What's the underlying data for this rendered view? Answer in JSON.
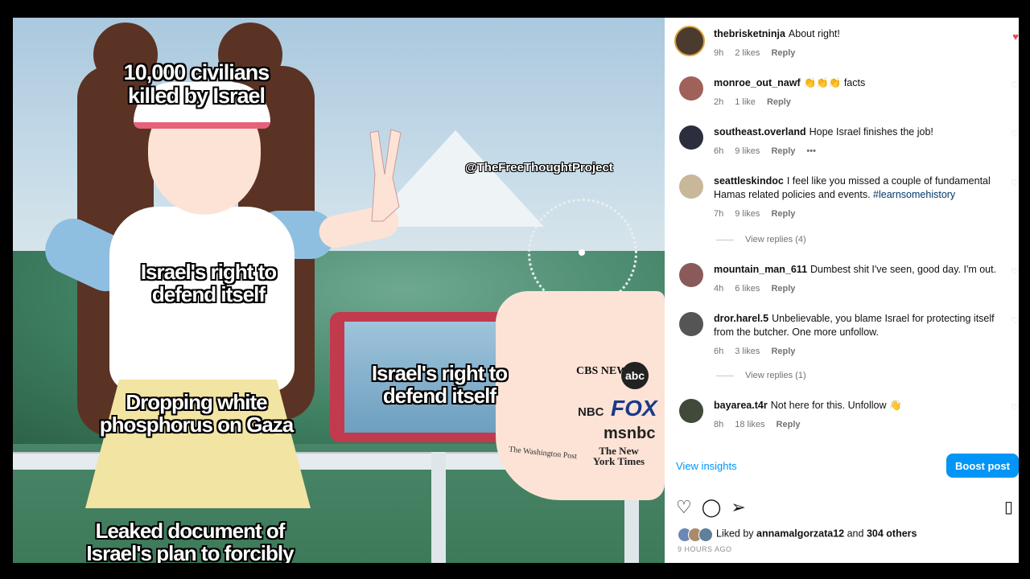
{
  "meme": {
    "caption_top": "10,000 civilians killed by Israel",
    "caption_mid": "Israel's right to defend itself",
    "caption_phone": "Israel's right to defend itself",
    "caption_lower": "Dropping white phosphorus on Gaza",
    "caption_bottom": "Leaked document of Israel's plan to forcibly",
    "watermark": "@TheFreeThoughtProject",
    "logos": [
      "CBS NEWS",
      "abc",
      "NBC",
      "FOX",
      "msnbc",
      "The Washington Post",
      "The New York Times"
    ]
  },
  "comments": [
    {
      "user": "thebrisketninja",
      "text": "About right!",
      "time": "9h",
      "likes": "2 likes",
      "reply": "Reply"
    },
    {
      "user": "monroe_out_nawf",
      "text": "👏👏👏 facts",
      "time": "2h",
      "likes": "1 like",
      "reply": "Reply"
    },
    {
      "user": "southeast.overland",
      "text": "Hope Israel finishes the job!",
      "time": "6h",
      "likes": "9 likes",
      "reply": "Reply",
      "more": "•••"
    },
    {
      "user": "seattleskindoc",
      "text": "I feel like you missed a couple of fundamental Hamas related policies and events.",
      "hashtag": "#learnsomehistory",
      "time": "7h",
      "likes": "9 likes",
      "reply": "Reply",
      "view_replies": "View replies (4)"
    },
    {
      "user": "mountain_man_611",
      "text": "Dumbest shit I've seen, good day. I'm out.",
      "time": "4h",
      "likes": "6 likes",
      "reply": "Reply"
    },
    {
      "user": "dror.harel.5",
      "text": "Unbelievable, you blame Israel for protecting itself from the butcher. One more unfollow.",
      "time": "6h",
      "likes": "3 likes",
      "reply": "Reply",
      "view_replies": "View replies (1)"
    },
    {
      "user": "bayarea.t4r",
      "text": "Not here for this. Unfollow 👋",
      "time": "8h",
      "likes": "18 likes",
      "reply": "Reply"
    }
  ],
  "footer": {
    "view_insights": "View insights",
    "boost_post": "Boost post",
    "liked_by_prefix": "Liked by",
    "liked_by_user": "annamalgorzata12",
    "liked_by_suffix": "and",
    "others": "304 others",
    "timestamp": "9 HOURS AGO"
  },
  "icons": {
    "like": "heart-icon",
    "comment": "comment-icon",
    "share": "share-icon",
    "save": "bookmark-icon"
  },
  "colors": {
    "accent": "#0095f6",
    "liked_heart": "#ed4956",
    "meta": "#737373"
  }
}
